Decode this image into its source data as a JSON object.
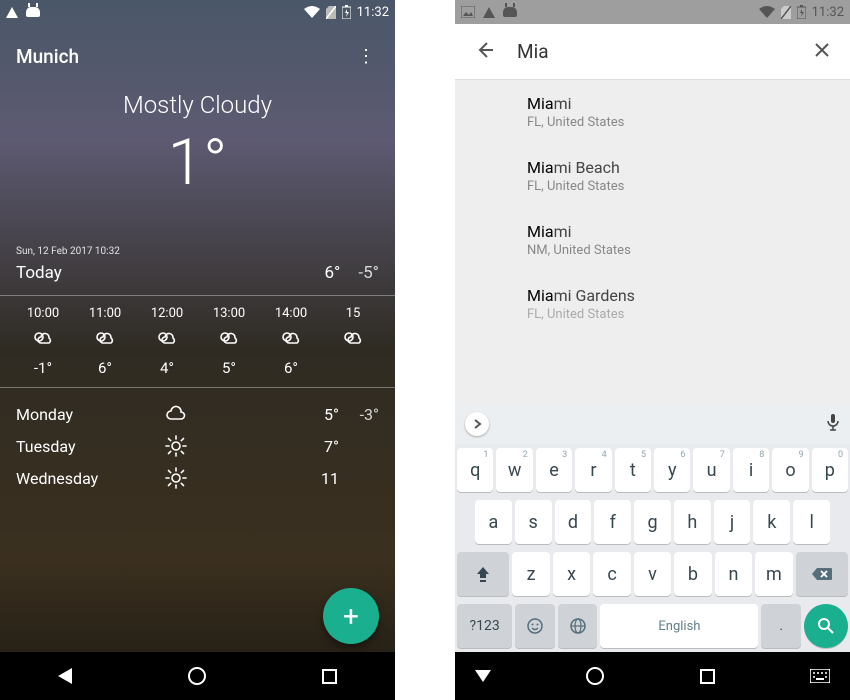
{
  "colors": {
    "accent": "#1aaf8e"
  },
  "left": {
    "status": {
      "time": "11:32"
    },
    "header": {
      "city": "Munich"
    },
    "hero": {
      "condition": "Mostly Cloudy",
      "temp": "1°"
    },
    "today": {
      "datetime": "Sun, 12 Feb 2017 10:32",
      "label": "Today",
      "high": "6°",
      "low": "-5°"
    },
    "hourly": [
      {
        "time": "10:00",
        "icon": "partly-cloudy",
        "temp": "-1°"
      },
      {
        "time": "11:00",
        "icon": "partly-cloudy",
        "temp": "6°"
      },
      {
        "time": "12:00",
        "icon": "partly-cloudy",
        "temp": "4°"
      },
      {
        "time": "13:00",
        "icon": "partly-cloudy",
        "temp": "5°"
      },
      {
        "time": "14:00",
        "icon": "partly-cloudy",
        "temp": "6°"
      },
      {
        "time": "15",
        "icon": "partly-cloudy",
        "temp": ""
      }
    ],
    "daily": [
      {
        "name": "Monday",
        "icon": "cloud",
        "high": "5°",
        "low": "-3°"
      },
      {
        "name": "Tuesday",
        "icon": "sun",
        "high": "7°",
        "low": ""
      },
      {
        "name": "Wednesday",
        "icon": "sun",
        "high": "11",
        "low": ""
      }
    ],
    "fab_label": "+"
  },
  "right": {
    "status": {
      "time": "11:32"
    },
    "search": {
      "value": "Mia"
    },
    "results": [
      {
        "match": "Mia",
        "rest": "mi",
        "sub": "FL, United States"
      },
      {
        "match": "Mia",
        "rest": "mi Beach",
        "sub": "FL, United States"
      },
      {
        "match": "Mia",
        "rest": "mi",
        "sub": "NM, United States"
      },
      {
        "match": "Mia",
        "rest": "mi Gardens",
        "sub": "FL, United States"
      }
    ],
    "keyboard": {
      "row1": [
        {
          "k": "q",
          "s": "1"
        },
        {
          "k": "w",
          "s": "2"
        },
        {
          "k": "e",
          "s": "3"
        },
        {
          "k": "r",
          "s": "4"
        },
        {
          "k": "t",
          "s": "5"
        },
        {
          "k": "y",
          "s": "6"
        },
        {
          "k": "u",
          "s": "7"
        },
        {
          "k": "i",
          "s": "8"
        },
        {
          "k": "o",
          "s": "9"
        },
        {
          "k": "p",
          "s": "0"
        }
      ],
      "row2": [
        "a",
        "s",
        "d",
        "f",
        "g",
        "h",
        "j",
        "k",
        "l"
      ],
      "row3": [
        "z",
        "x",
        "c",
        "v",
        "b",
        "n",
        "m"
      ],
      "switch_label": "?123",
      "space_label": "English",
      "period": "."
    }
  }
}
